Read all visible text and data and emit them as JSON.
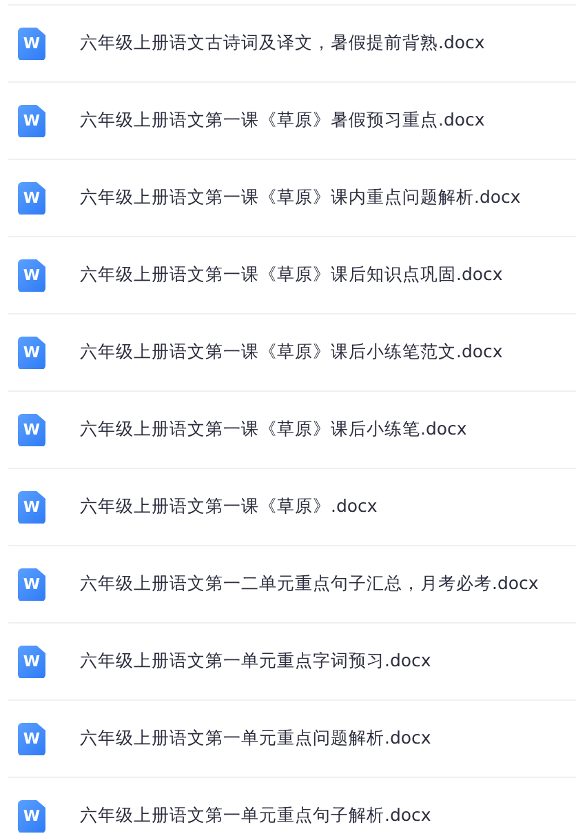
{
  "files": [
    {
      "badge": "W",
      "name": "六年级上册语文古诗词及译文，暑假提前背熟.docx"
    },
    {
      "badge": "W",
      "name": "六年级上册语文第一课《草原》暑假预习重点.docx"
    },
    {
      "badge": "W",
      "name": "六年级上册语文第一课《草原》课内重点问题解析.docx"
    },
    {
      "badge": "W",
      "name": "六年级上册语文第一课《草原》课后知识点巩固.docx"
    },
    {
      "badge": "W",
      "name": "六年级上册语文第一课《草原》课后小练笔范文.docx"
    },
    {
      "badge": "W",
      "name": "六年级上册语文第一课《草原》课后小练笔.docx"
    },
    {
      "badge": "W",
      "name": "六年级上册语文第一课《草原》.docx"
    },
    {
      "badge": "W",
      "name": "六年级上册语文第一二单元重点句子汇总，月考必考.docx"
    },
    {
      "badge": "W",
      "name": "六年级上册语文第一单元重点字词预习.docx"
    },
    {
      "badge": "W",
      "name": "六年级上册语文第一单元重点问题解析.docx"
    },
    {
      "badge": "W",
      "name": "六年级上册语文第一单元重点句子解析.docx"
    }
  ]
}
